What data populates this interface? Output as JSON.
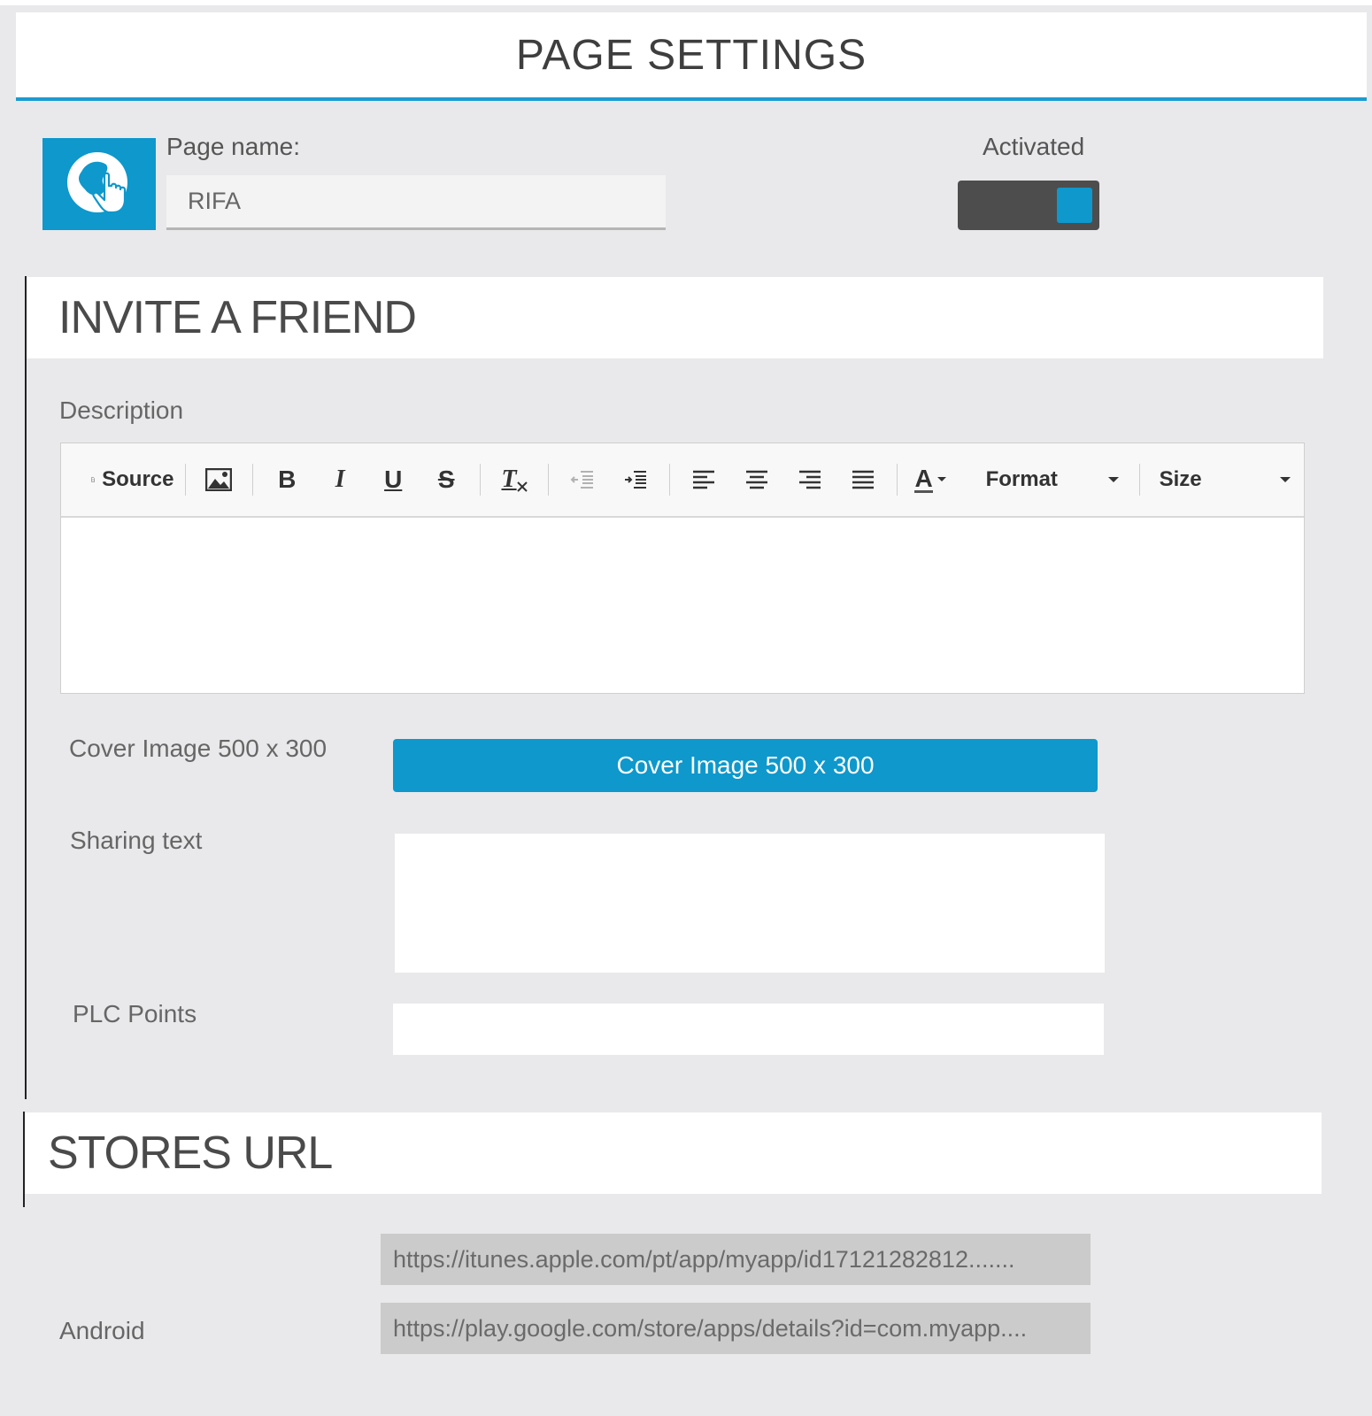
{
  "header": {
    "title": "PAGE SETTINGS"
  },
  "page": {
    "icon": "globe-touch-icon",
    "name_label": "Page name:",
    "name_value": "RIFA",
    "activated_label": "Activated",
    "activated": true
  },
  "invite": {
    "title": "INVITE A FRIEND",
    "description_label": "Description",
    "toolbar": {
      "source_label": "Source",
      "image_icon": "image-icon",
      "bold_glyph": "B",
      "italic_glyph": "I",
      "underline_glyph": "U",
      "strike_glyph": "S",
      "clear_glyph": "T",
      "font_color_glyph": "A",
      "format_label": "Format",
      "size_label": "Size"
    },
    "cover_label": "Cover Image 500 x 300",
    "cover_button": "Cover Image 500 x 300",
    "sharing_label": "Sharing text",
    "points_label": "PLC Points"
  },
  "stores": {
    "title": "STORES URL",
    "ios_url": "https://itunes.apple.com/pt/app/myapp/id17121282812.......",
    "android_label": "Android",
    "android_url": "https://play.google.com/store/apps/details?id=com.myapp...."
  },
  "colors": {
    "accent": "#0e98cc",
    "header_rule": "#1b9bd0",
    "toggle_bg": "#4d4d4d",
    "panel_bg": "#e9e9eb"
  }
}
